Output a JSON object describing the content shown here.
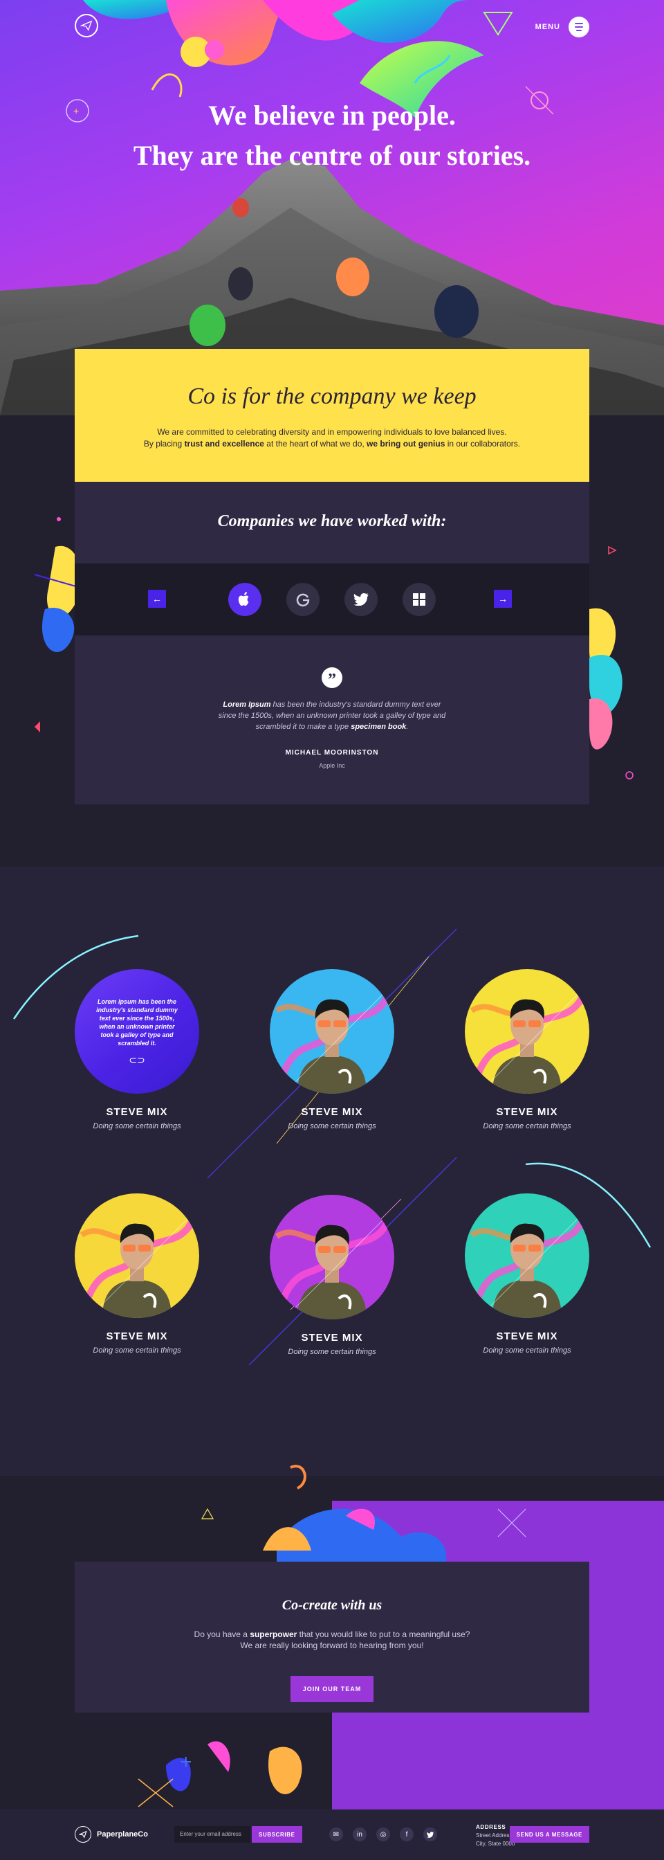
{
  "hero": {
    "menu_label": "MENU",
    "title_line1": "We believe in people.",
    "title_line2": "They are the centre of our stories."
  },
  "intro": {
    "heading": "Co is for the company we keep",
    "line1": "We are committed to celebrating diversity and in empowering individuals to love balanced lives.",
    "line2_prefix": "By placing ",
    "line2_bold1": "trust and excellence",
    "line2_mid": " at the heart of what we do, ",
    "line2_bold2": "we bring out genius",
    "line2_suffix": " in our collaborators."
  },
  "companies": {
    "heading": "Companies we have worked with:",
    "prev_arrow": "←",
    "next_arrow": "→",
    "brands": [
      "apple",
      "google",
      "twitter",
      "windows"
    ]
  },
  "testimonial": {
    "quote_mark": "”",
    "bold_start": "Lorem Ipsum",
    "text_mid": " has been the industry's standard dummy text ever since the 1500s, when an unknown printer took a galley of type and scrambled it to make a type ",
    "bold_end": "specimen book",
    "text_end": ".",
    "name": "MICHAEL MOORINSTON",
    "company": "Apple Inc"
  },
  "team": {
    "info_text": "Lorem Ipsum has been the industry's standard dummy text ever since the 1500s, when an unknown printer took a galley of type and scrambled it.",
    "members": [
      {
        "name": "STEVE MIX",
        "role": "Doing some certain things",
        "bg": "#4a23e8"
      },
      {
        "name": "STEVE MIX",
        "role": "Doing some certain things",
        "bg": "#3ab6f0"
      },
      {
        "name": "STEVE MIX",
        "role": "Doing some certain things",
        "bg": "#f6e13a"
      },
      {
        "name": "STEVE MIX",
        "role": "Doing some certain things",
        "bg": "#f6d83a"
      },
      {
        "name": "STEVE MIX",
        "role": "Doing some certain things",
        "bg": "#b23ce0"
      },
      {
        "name": "STEVE MIX",
        "role": "Doing some certain things",
        "bg": "#2fd1b8"
      }
    ]
  },
  "cta": {
    "heading": "Co-create with us",
    "line1_prefix": "Do you have a ",
    "line1_bold": "superpower",
    "line1_suffix": " that you would like to put to a meaningful use?",
    "line2": "We are really looking forward to hearing from you!",
    "button": "JOIN OUR TEAM"
  },
  "footer": {
    "brand": "PaperplaneCo",
    "email_placeholder": "Enter your email address",
    "subscribe": "SUBSCRIBE",
    "address_label": "ADDRESS",
    "address_line1": "Street Address",
    "address_line2": "City, State 0000",
    "message_button": "SEND US A MESSAGE"
  },
  "colors": {
    "accent_purple": "#9a37d8",
    "accent_blue": "#4a23e8",
    "accent_yellow": "#ffe14b",
    "panel": "#2f2944",
    "dark": "#22202f"
  }
}
